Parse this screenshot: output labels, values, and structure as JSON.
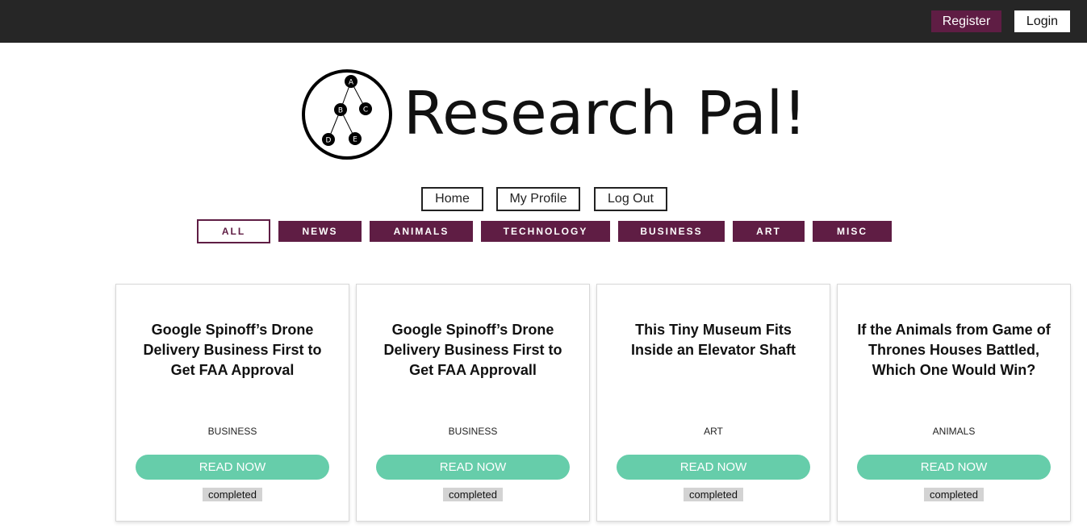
{
  "topbar": {
    "register_label": "Register",
    "login_label": "Login"
  },
  "logo": {
    "nodes": [
      "A",
      "B",
      "C",
      "D",
      "E"
    ],
    "text": "Research Pal!"
  },
  "nav": {
    "home": "Home",
    "profile": "My Profile",
    "logout": "Log Out"
  },
  "categories": [
    "ALL",
    "NEWS",
    "ANIMALS",
    "TECHNOLOGY",
    "BUSINESS",
    "ART",
    "MISC"
  ],
  "active_category": "ALL",
  "articles": [
    {
      "title": "Google Spinoff’s Drone Delivery Business First to Get FAA Approval",
      "category": "BUSINESS",
      "action": "READ NOW",
      "status": "completed"
    },
    {
      "title": "Google Spinoff’s Drone Delivery Business First to Get FAA Approvall",
      "category": "BUSINESS",
      "action": "READ NOW",
      "status": "completed"
    },
    {
      "title": "This Tiny Museum Fits Inside an Elevator Shaft",
      "category": "ART",
      "action": "READ NOW",
      "status": "completed"
    },
    {
      "title": "If the Animals from Game of Thrones Houses Battled, Which One Would Win?",
      "category": "ANIMALS",
      "action": "READ NOW",
      "status": "completed"
    }
  ],
  "colors": {
    "brand": "#5f1d44",
    "accent": "#66cdaa",
    "topbar": "#262626",
    "badge": "#d3d3d3"
  }
}
